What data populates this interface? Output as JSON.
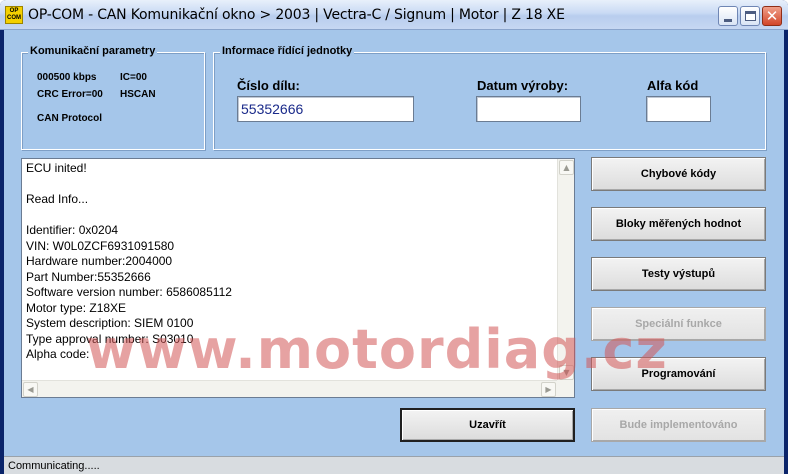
{
  "window": {
    "title": "OP-COM - CAN Komunikační okno > 2003 | Vectra-C / Signum | Motor | Z 18 XE",
    "icon_top": "OP",
    "icon_bottom": "COM",
    "close_glyph": "✕"
  },
  "comm_params": {
    "title": "Komunikační parametry",
    "speed": "000500 kbps",
    "ic": "IC=00",
    "crc": "CRC Error=00",
    "hscan": "HSCAN",
    "protocol": "CAN Protocol"
  },
  "ecu_info": {
    "title": "Informace řídící jednotky",
    "part_label": "Číslo dílu:",
    "part_value": "55352666",
    "date_label": "Datum výroby:",
    "date_value": "",
    "alpha_label": "Alfa kód",
    "alpha_value": ""
  },
  "log": {
    "lines": [
      "ECU inited!",
      "",
      "Read Info...",
      "",
      "Identifier: 0x0204",
      "VIN: W0L0ZCF6931091580",
      "Hardware number:2004000",
      "Part Number:55352666",
      "Software version number: 6586085112",
      "Motor type: Z18XE",
      "System description: SIEM 0100",
      "Type approval number: S03010",
      "Alpha code:"
    ]
  },
  "buttons": {
    "fault_codes": "Chybové kódy",
    "measured_blocks": "Bloky měřených hodnot",
    "output_tests": "Testy výstupů",
    "special_functions": "Speciální funkce",
    "programming": "Programování",
    "close": "Uzavřít",
    "to_be_implemented": "Bude implementováno"
  },
  "scroll": {
    "up": "▲",
    "down": "▼",
    "left": "◀",
    "right": "▶"
  },
  "status": {
    "text": "Communicating....."
  },
  "watermark": "www.motordiag.cz"
}
